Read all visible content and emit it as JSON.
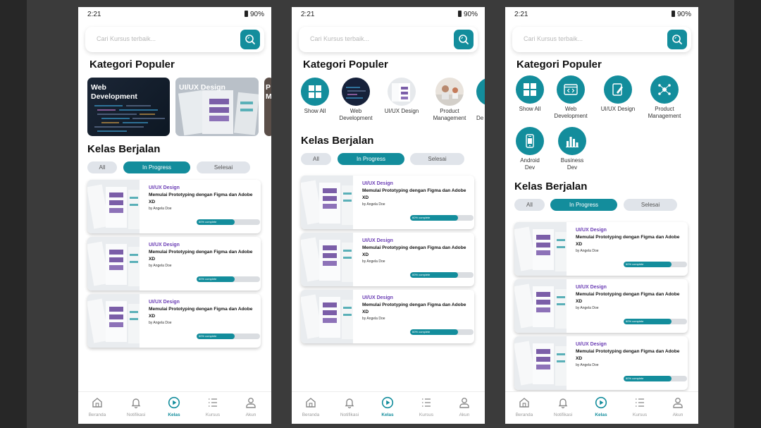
{
  "statusbar": {
    "time": "2:21",
    "battery": "90%"
  },
  "search": {
    "placeholder": "Cari Kursus terbaik..."
  },
  "headings": {
    "kategori": "Kategori Populer",
    "kelas": "Kelas Berjalan"
  },
  "category_cards": [
    {
      "label": "Web\nDevelopment"
    },
    {
      "label": "UI/UX Design"
    },
    {
      "label": "P\nM"
    }
  ],
  "category_items_v2": [
    {
      "label": "Show All",
      "icon": "grid-icon"
    },
    {
      "label": "Web\nDevelopment",
      "icon": "code-thumbnail"
    },
    {
      "label": "UI/UX Design",
      "icon": "design-thumbnail"
    },
    {
      "label": "Product\nManagement",
      "icon": "office-thumbnail"
    },
    {
      "label": "De",
      "icon": "partial"
    }
  ],
  "category_items_v3": [
    {
      "label": "Show All",
      "icon": "grid-icon"
    },
    {
      "label": "Web\nDevelopment",
      "icon": "browser-code-icon"
    },
    {
      "label": "UI/UX Design",
      "icon": "pen-tablet-icon"
    },
    {
      "label": "Product\nManagement",
      "icon": "network-icon"
    },
    {
      "label": "Android\nDev",
      "icon": "phone-icon"
    },
    {
      "label": "Business\nDev",
      "icon": "bar-chart-icon"
    }
  ],
  "filters": [
    {
      "label": "All",
      "active": false
    },
    {
      "label": "In Progress",
      "active": true
    },
    {
      "label": "Selesai",
      "active": false
    }
  ],
  "course": {
    "category": "UI/UX Design",
    "title": "Memulai Prototyping dengan Figma dan Adobe XD",
    "author": "by Angela Doe",
    "progress_label": "60% complete",
    "progress": 0.6
  },
  "nav": [
    {
      "label": "Beranda",
      "icon": "home-icon"
    },
    {
      "label": "Notifikasi",
      "icon": "bell-icon"
    },
    {
      "label": "Kelas",
      "icon": "play-icon",
      "active": true
    },
    {
      "label": "Kursus",
      "icon": "list-icon"
    },
    {
      "label": "Akun",
      "icon": "user-icon"
    }
  ],
  "colors": {
    "accent": "#138d9c",
    "category_text": "#6c3fb5",
    "pill_inactive": "#e0e4ea"
  }
}
